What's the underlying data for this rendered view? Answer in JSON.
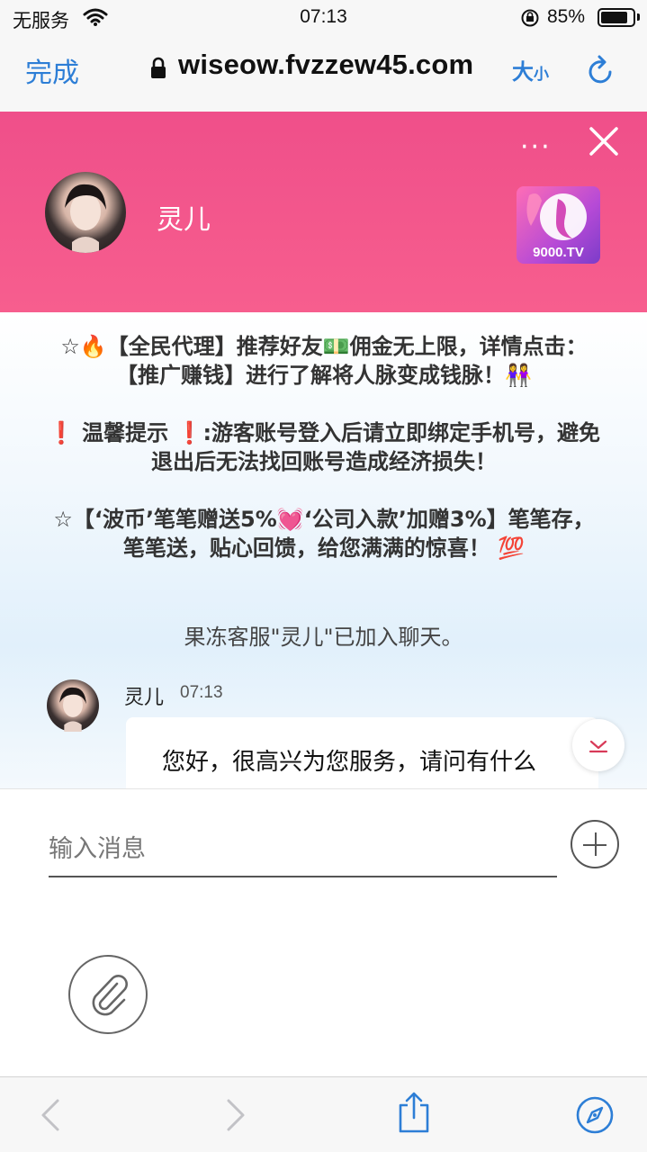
{
  "status_bar": {
    "carrier": "无服务",
    "time": "07:13",
    "battery": "85%",
    "battery_level": 0.85,
    "icons": [
      "wifi-icon",
      "orientation-lock-icon",
      "battery-icon"
    ]
  },
  "browser": {
    "done_label": "完成",
    "url": "wiseow.fvzzew45.com",
    "text_size_big": "大",
    "text_size_small": "小",
    "accent_color": "#2d7ed6",
    "icons": [
      "lock-icon",
      "reload-icon"
    ]
  },
  "chat_header": {
    "more_label": "···",
    "agent_name": "灵儿",
    "brand_logo_text": "9000.TV",
    "header_color": "#f0508a",
    "icons": [
      "more-icon",
      "close-icon"
    ]
  },
  "notices": {
    "n1_a": "☆🔥【全民代理】推荐好友💵佣金无上限，详情点击：【推广赚钱】进行了解将人脉变成钱脉！👭",
    "n2_warn1": "❗",
    "n2_text": " 温馨提示 ",
    "n2_warn2": "❗",
    "n2_rest": ":游客账号登入后请立即绑定手机号，避免退出后无法找回账号造成经济损失！",
    "n3": "☆【‘波币’笔笔赠送5%💓‘公司入款’加赠3%】笔笔存，笔笔送，贴心回馈，给您满满的惊喜！ 💯"
  },
  "chat": {
    "joined_text": "果冻客服\"灵儿\"已加入聊天。",
    "message": {
      "sender": "灵儿",
      "time": "07:13",
      "text": "您好，很高兴为您服务，请问有什么"
    }
  },
  "input": {
    "placeholder": "输入消息",
    "icons": [
      "plus-icon",
      "paperclip-icon"
    ]
  },
  "bottom_bar": {
    "icons": [
      "back-icon",
      "forward-icon",
      "share-icon",
      "compass-icon"
    ]
  }
}
